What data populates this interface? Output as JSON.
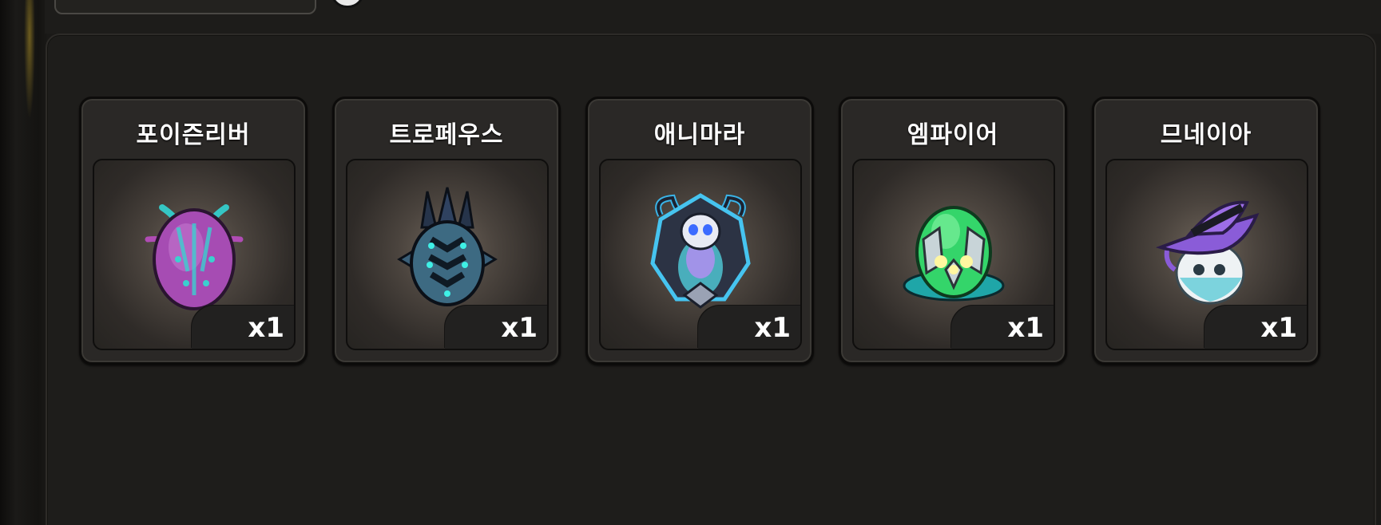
{
  "items": [
    {
      "name": "포이즌리버",
      "quantity": "x1",
      "icon": "poison-egg-icon"
    },
    {
      "name": "트로페우스",
      "quantity": "x1",
      "icon": "spiked-dragon-egg-icon"
    },
    {
      "name": "애니마라",
      "quantity": "x1",
      "icon": "skull-crest-egg-icon"
    },
    {
      "name": "엠파이어",
      "quantity": "x1",
      "icon": "green-gem-egg-icon"
    },
    {
      "name": "므네이아",
      "quantity": "x1",
      "icon": "witch-hat-egg-icon"
    }
  ],
  "colors": {
    "panel": "#1e1d1b",
    "card": "#2a2826",
    "text": "#ffffff"
  }
}
